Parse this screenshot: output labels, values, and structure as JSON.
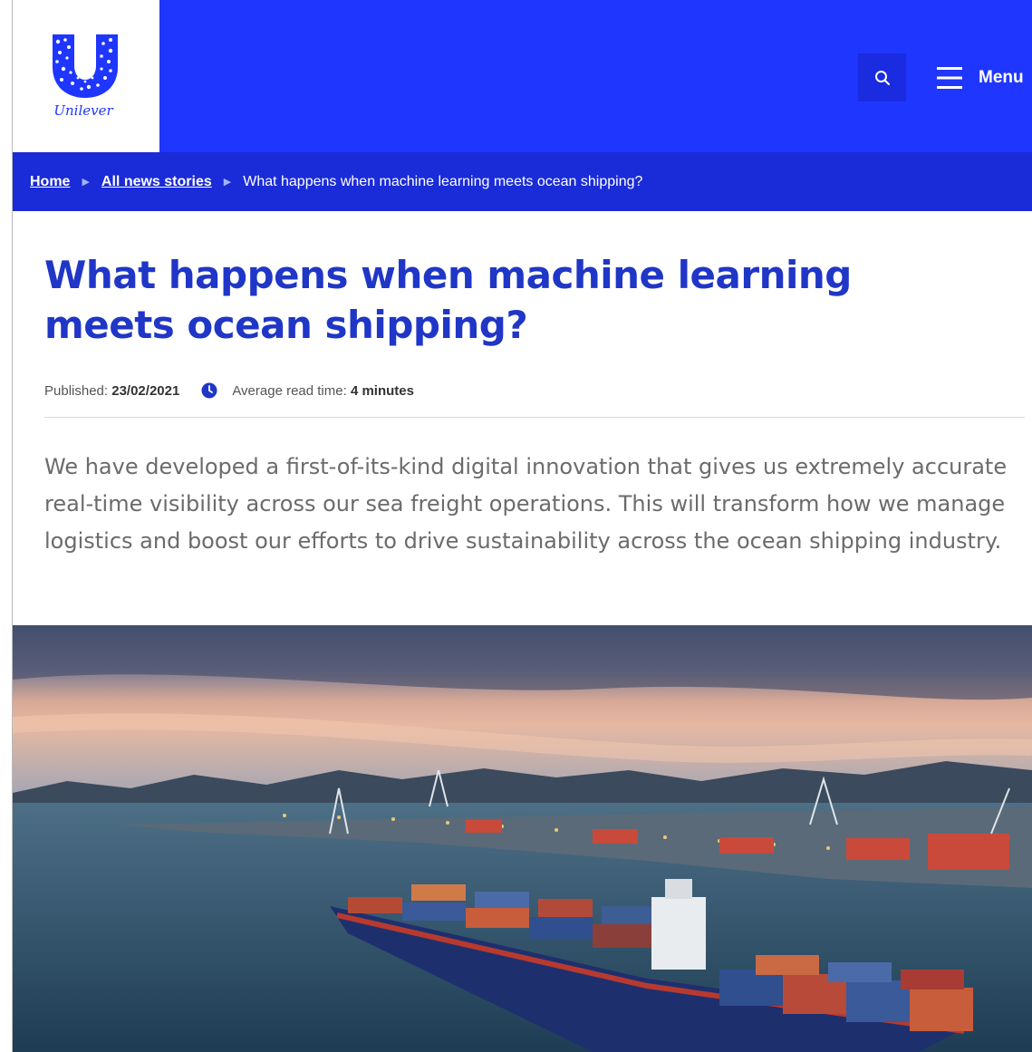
{
  "brand": {
    "logo_text": "Unilever",
    "primary_color": "#1f36ff"
  },
  "header": {
    "search_icon": "search-icon",
    "menu_label": "Menu",
    "menu_icon": "hamburger-icon"
  },
  "breadcrumb": {
    "items": [
      {
        "label": "Home"
      },
      {
        "label": "All news stories"
      },
      {
        "label": "What happens when machine learning meets ocean shipping?"
      }
    ]
  },
  "article": {
    "title_line1": "What happens when machine learning",
    "title_line2": "meets ocean shipping?",
    "published_label": "Published:",
    "published_date": "23/02/2021",
    "read_time_label": "Average read time:",
    "read_time_value": "4 minutes",
    "intro": "We have developed a first-of-its-kind digital innovation that gives us extremely accurate real-time visibility across our sea freight operations. This will transform how we manage logistics and boost our efforts to drive sustainability across the ocean shipping industry."
  },
  "hero_image": {
    "subject": "container-ship-port-icon"
  }
}
